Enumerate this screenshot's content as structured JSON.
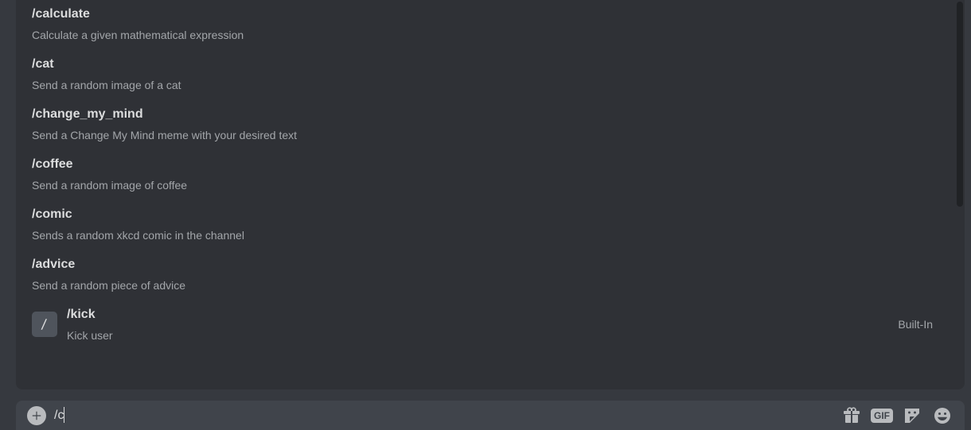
{
  "commands": [
    {
      "name": "/calculate",
      "desc": "Calculate a given mathematical expression",
      "has_icon": false,
      "source": ""
    },
    {
      "name": "/cat",
      "desc": "Send a random image of a cat",
      "has_icon": false,
      "source": ""
    },
    {
      "name": "/change_my_mind",
      "desc": "Send a Change My Mind meme with your desired text",
      "has_icon": false,
      "source": ""
    },
    {
      "name": "/coffee",
      "desc": "Send a random image of coffee",
      "has_icon": false,
      "source": ""
    },
    {
      "name": "/comic",
      "desc": "Sends a random xkcd comic in the channel",
      "has_icon": false,
      "source": ""
    },
    {
      "name": "/advice",
      "desc": "Send a random piece of advice",
      "has_icon": false,
      "source": ""
    },
    {
      "name": "/kick",
      "desc": "Kick user",
      "has_icon": true,
      "source": "Built-In"
    }
  ],
  "input": {
    "value": "/c"
  },
  "gif_label": "GIF"
}
